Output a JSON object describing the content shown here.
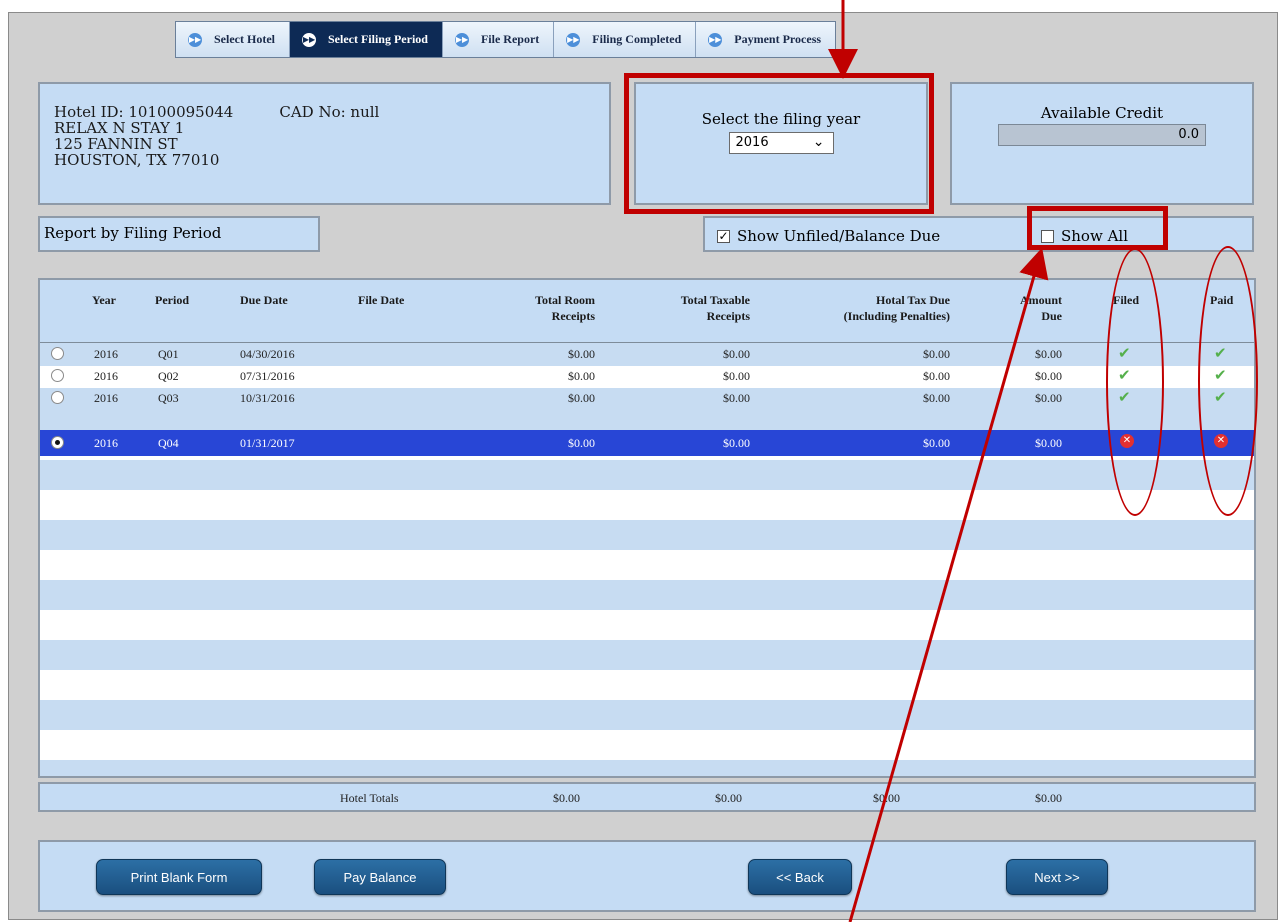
{
  "tabs": [
    {
      "label": "Select Hotel",
      "active": false
    },
    {
      "label": "Select Filing Period",
      "active": true
    },
    {
      "label": "File Report",
      "active": false
    },
    {
      "label": "Filing Completed",
      "active": false
    },
    {
      "label": "Payment Process",
      "active": false
    }
  ],
  "hotel": {
    "id_line": "Hotel ID: 10100095044",
    "cad_line": "CAD No: null",
    "name": "RELAX N STAY 1",
    "street": "125 FANNIN ST",
    "city_line": "HOUSTON, TX  77010"
  },
  "filing_year": {
    "label": "Select the filing year",
    "selected": "2016"
  },
  "credit": {
    "label": "Available Credit",
    "value": "0.0"
  },
  "report_label": "Report by Filing Period",
  "filters": {
    "unfiled": {
      "label": "Show Unfiled/Balance Due",
      "checked": true
    },
    "show_all": {
      "label": "Show All",
      "checked": false
    }
  },
  "table": {
    "headers": {
      "year": "Year",
      "period": "Period",
      "due_date": "Due Date",
      "file_date": "File Date",
      "room_1": "Total Room",
      "room_2": "Receipts",
      "taxable_1": "Total Taxable",
      "taxable_2": "Receipts",
      "tax_1": "Hotal Tax Due",
      "tax_2": "(Including Penalties)",
      "amount_1": "Amount",
      "amount_2": "Due",
      "filed": "Filed",
      "paid": "Paid"
    },
    "rows": [
      {
        "year": "2016",
        "period": "Q01",
        "due_date": "04/30/2016",
        "file_date": "",
        "room": "$0.00",
        "taxable": "$0.00",
        "tax": "$0.00",
        "amount": "$0.00",
        "filed": true,
        "paid": true,
        "selected": false
      },
      {
        "year": "2016",
        "period": "Q02",
        "due_date": "07/31/2016",
        "file_date": "",
        "room": "$0.00",
        "taxable": "$0.00",
        "tax": "$0.00",
        "amount": "$0.00",
        "filed": true,
        "paid": true,
        "selected": false
      },
      {
        "year": "2016",
        "period": "Q03",
        "due_date": "10/31/2016",
        "file_date": "",
        "room": "$0.00",
        "taxable": "$0.00",
        "tax": "$0.00",
        "amount": "$0.00",
        "filed": true,
        "paid": true,
        "selected": false
      },
      {
        "year": "2016",
        "period": "Q04",
        "due_date": "01/31/2017",
        "file_date": "",
        "room": "$0.00",
        "taxable": "$0.00",
        "tax": "$0.00",
        "amount": "$0.00",
        "filed": false,
        "paid": false,
        "selected": true
      }
    ]
  },
  "totals": {
    "label": "Hotel Totals",
    "room": "$0.00",
    "taxable": "$0.00",
    "tax": "$0.00",
    "amount": "$0.00"
  },
  "buttons": {
    "print_blank": "Print Blank Form",
    "pay_balance": "Pay Balance",
    "back": "<< Back",
    "next": "Next >>"
  },
  "icons": {
    "tab": "arrow-circle-icon",
    "filed_ok": "checkmark-icon",
    "not_filed": "red-x-icon"
  },
  "colors": {
    "selected_row": "#2846d6",
    "annotation": "#c00000",
    "active_tab": "#0d2a55"
  }
}
